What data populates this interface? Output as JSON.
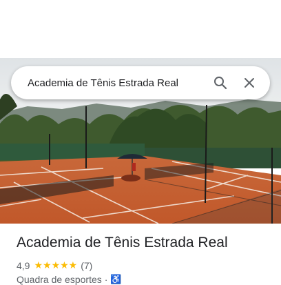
{
  "search": {
    "query": "Academia de Tênis Estrada Real"
  },
  "place": {
    "name": "Academia de Tênis Estrada Real",
    "rating": "4,9",
    "stars": "★★★★★",
    "review_count": "(7)",
    "category": "Quadra de esportes",
    "separator": "·",
    "accessibility_icon": "wheelchair-icon"
  },
  "colors": {
    "star": "#fbbc04",
    "clay": "#c65a2a",
    "accent": "#1a73e8"
  }
}
